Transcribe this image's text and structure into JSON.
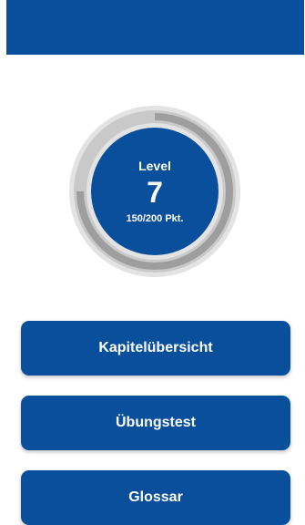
{
  "colors": {
    "primary": "#0a4f9c",
    "ring_track": "#c9c9c9",
    "ring_progress": "#9e9e9e"
  },
  "level": {
    "label": "Level",
    "value": "7",
    "points_text": "150/200 Pkt.",
    "progress_fraction": 0.75
  },
  "menu": {
    "buttons": [
      {
        "label": "Kapitelübersicht"
      },
      {
        "label": "Übungstest"
      },
      {
        "label": "Glossar"
      }
    ]
  }
}
